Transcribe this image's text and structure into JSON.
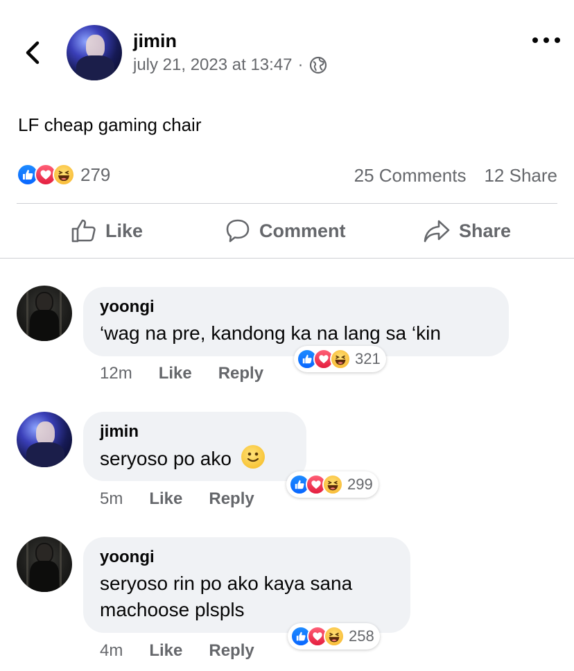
{
  "post": {
    "author": "jimin",
    "timestamp": "july 21, 2023 at 13:47",
    "separator": "·",
    "privacy_icon": "globe-icon",
    "text": "LF cheap gaming chair",
    "reaction_count": "279",
    "comments_label": "25 Comments",
    "shares_label": "12 Share"
  },
  "actions": {
    "like": "Like",
    "comment": "Comment",
    "share": "Share"
  },
  "comments": [
    {
      "author": "yoongi",
      "text": "‘wag na pre, kandong ka na lang sa ‘kin",
      "time": "12m",
      "like_label": "Like",
      "reply_label": "Reply",
      "reaction_count": "321"
    },
    {
      "author": "jimin",
      "text": "seryoso po ako",
      "emoji": "slightly-smiling-face",
      "time": "5m",
      "like_label": "Like",
      "reply_label": "Reply",
      "reaction_count": "299"
    },
    {
      "author": "yoongi",
      "text_line1": "seryoso rin po ako kaya sana",
      "text_line2": "machoose plspls",
      "time": "4m",
      "like_label": "Like",
      "reply_label": "Reply",
      "reaction_count": "258"
    }
  ],
  "colors": {
    "like_blue": "#0866ff",
    "love_red": "#e41e3f",
    "haha_yellow": "#f7b125",
    "secondary_text": "#65676b",
    "bubble_bg": "#f0f2f5"
  }
}
